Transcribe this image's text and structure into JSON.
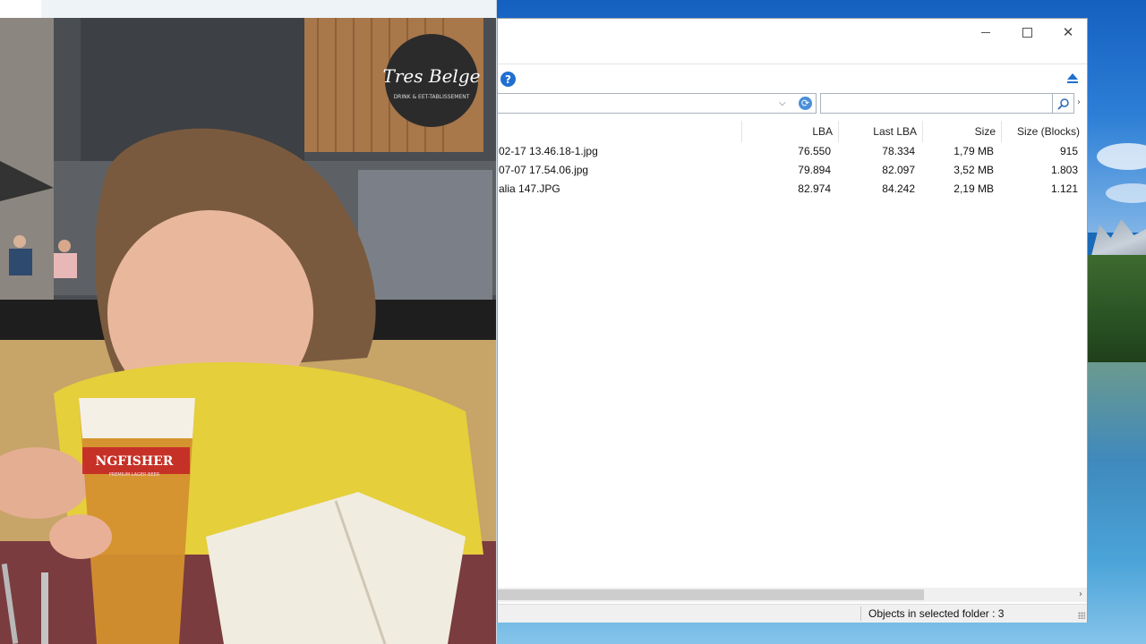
{
  "explorer": {
    "title_buttons": {
      "minimize": "—",
      "maximize": "□",
      "close": "✕"
    },
    "address": {
      "value": "",
      "dropdown_glyph": "⌵"
    },
    "search": {
      "value": "",
      "icon": "search-icon",
      "more_glyph": "›"
    },
    "help_glyph": "?",
    "columns": [
      "LBA",
      "Last LBA",
      "Size",
      "Size (Blocks)"
    ],
    "rows": [
      {
        "name": "02-17 13.46.18-1.jpg",
        "lba": "76.550",
        "last_lba": "78.334",
        "size": "1,79 MB",
        "blocks": "915"
      },
      {
        "name": "07-07 17.54.06.jpg",
        "lba": "79.894",
        "last_lba": "82.097",
        "size": "3,52 MB",
        "blocks": "1.803"
      },
      {
        "name": "alia 147.JPG",
        "lba": "82.974",
        "last_lba": "84.242",
        "size": "2,19 MB",
        "blocks": "1.121"
      }
    ],
    "sort_glyph": "^",
    "scroll_right_glyph": "›",
    "status": "Objects in selected folder : 3"
  },
  "photo": {
    "sign_text": "Tres Belge",
    "sign_subtext": "DRINK & EET-TABLISSEMENT",
    "glass_label": "NGFISHER",
    "glass_sublabel": "PREMIUM LAGER BEER"
  },
  "colors": {
    "accent": "#1f6fd1",
    "window_bg": "#ffffff",
    "status_bg": "#f0f0f0"
  }
}
